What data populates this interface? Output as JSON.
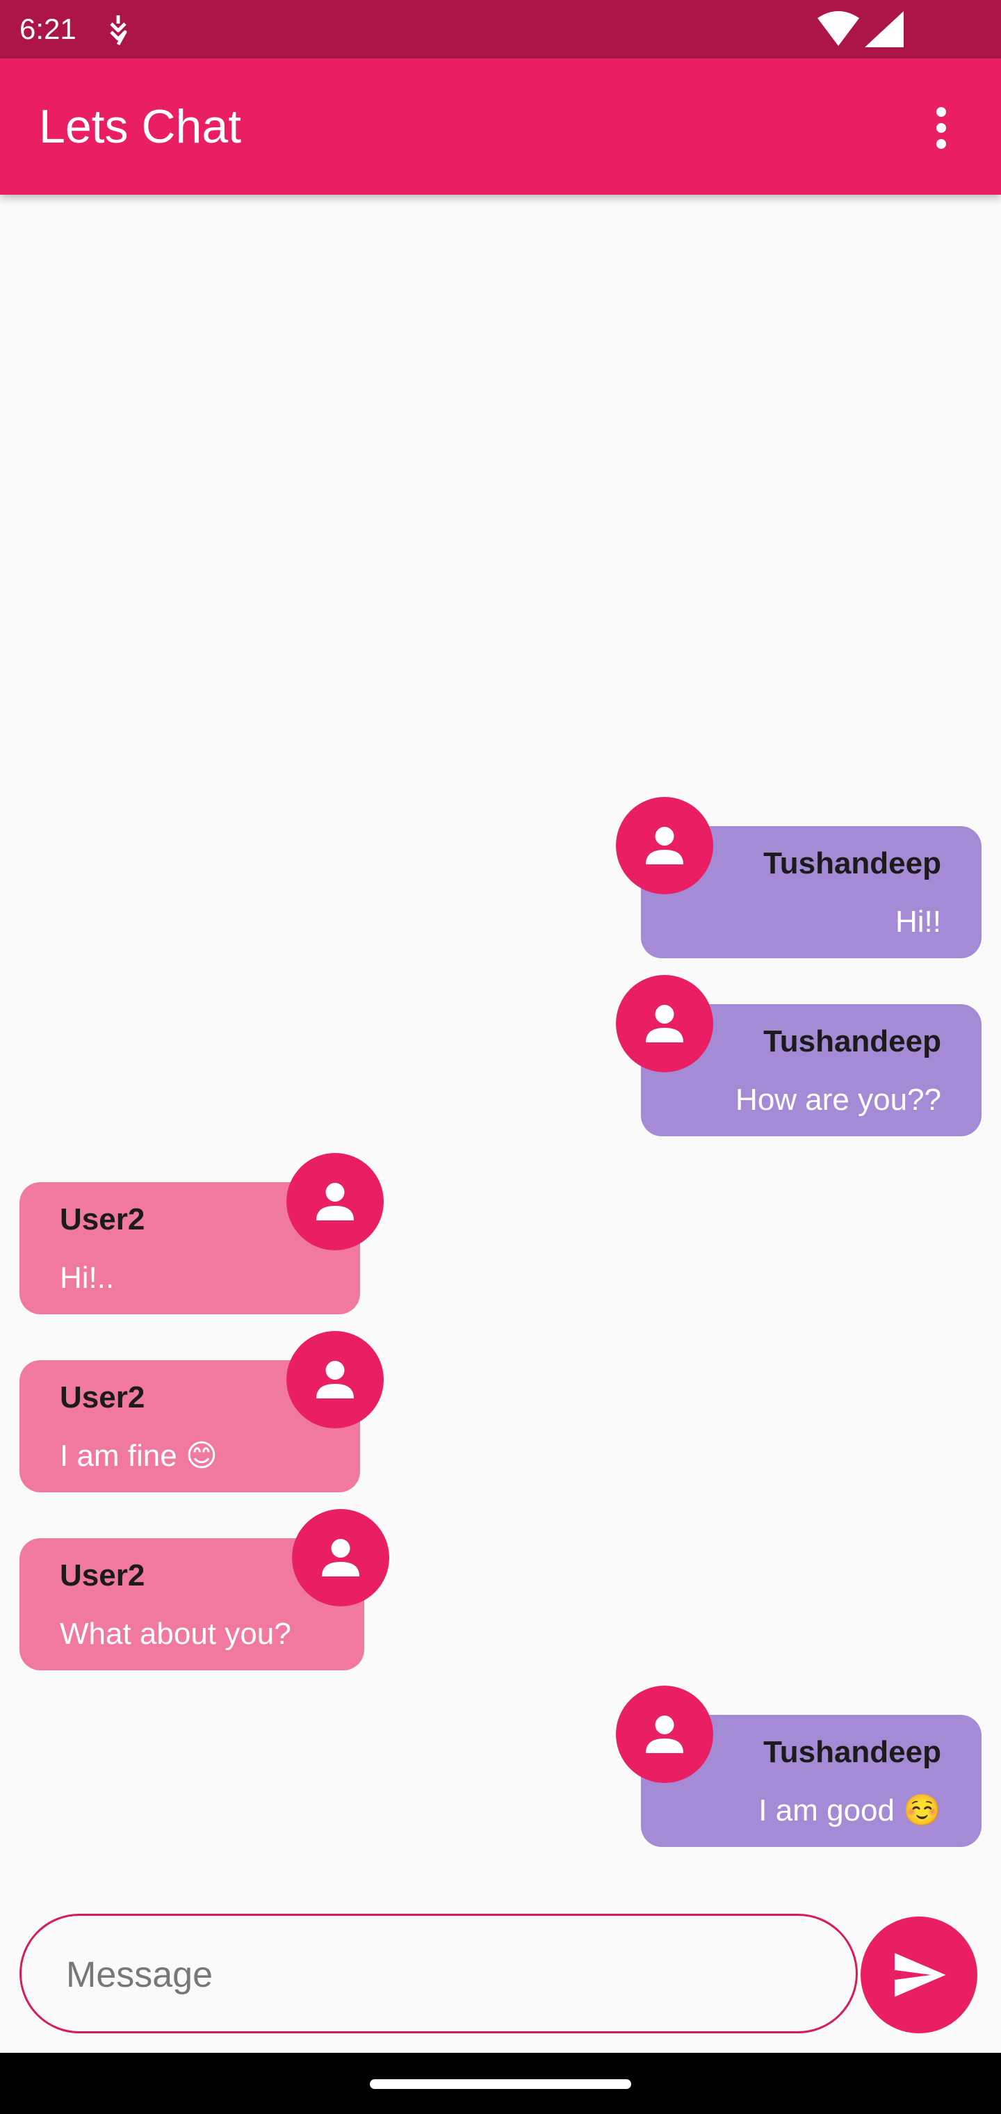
{
  "status_bar": {
    "time": "6:21",
    "icons": [
      "notification-glyph",
      "wifi-icon",
      "cellular-signal-icon"
    ]
  },
  "app_bar": {
    "title": "Lets Chat",
    "menu_icon": "more-vert-icon"
  },
  "colors": {
    "status_bar": "#ad1547",
    "app_bar": "#e91e63",
    "sent_bubble": "#a58bd6",
    "received_bubble": "#f2799e",
    "accent": "#e91e63"
  },
  "messages": [
    {
      "sender": "Tushandeep",
      "text": "Hi!!",
      "direction": "sent"
    },
    {
      "sender": "Tushandeep",
      "text": "How are you??",
      "direction": "sent"
    },
    {
      "sender": "User2",
      "text": "Hi!..",
      "direction": "received"
    },
    {
      "sender": "User2",
      "text": "I am fine 😊",
      "direction": "received"
    },
    {
      "sender": "User2",
      "text": "What about you?",
      "direction": "received"
    },
    {
      "sender": "Tushandeep",
      "text": "I am good ☺️",
      "direction": "sent"
    }
  ],
  "composer": {
    "placeholder": "Message",
    "value": "",
    "send_icon": "send-icon"
  }
}
